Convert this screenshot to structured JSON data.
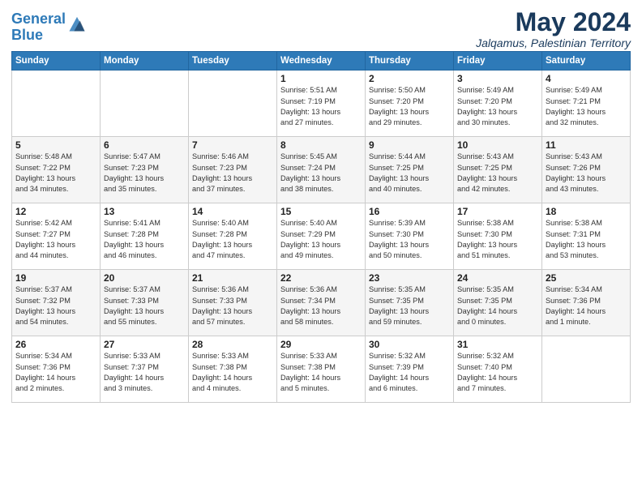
{
  "header": {
    "logo_line1": "General",
    "logo_line2": "Blue",
    "month_title": "May 2024",
    "location": "Jalqamus, Palestinian Territory"
  },
  "weekdays": [
    "Sunday",
    "Monday",
    "Tuesday",
    "Wednesday",
    "Thursday",
    "Friday",
    "Saturday"
  ],
  "weeks": [
    [
      {
        "day": "",
        "info": ""
      },
      {
        "day": "",
        "info": ""
      },
      {
        "day": "",
        "info": ""
      },
      {
        "day": "1",
        "info": "Sunrise: 5:51 AM\nSunset: 7:19 PM\nDaylight: 13 hours\nand 27 minutes."
      },
      {
        "day": "2",
        "info": "Sunrise: 5:50 AM\nSunset: 7:20 PM\nDaylight: 13 hours\nand 29 minutes."
      },
      {
        "day": "3",
        "info": "Sunrise: 5:49 AM\nSunset: 7:20 PM\nDaylight: 13 hours\nand 30 minutes."
      },
      {
        "day": "4",
        "info": "Sunrise: 5:49 AM\nSunset: 7:21 PM\nDaylight: 13 hours\nand 32 minutes."
      }
    ],
    [
      {
        "day": "5",
        "info": "Sunrise: 5:48 AM\nSunset: 7:22 PM\nDaylight: 13 hours\nand 34 minutes."
      },
      {
        "day": "6",
        "info": "Sunrise: 5:47 AM\nSunset: 7:23 PM\nDaylight: 13 hours\nand 35 minutes."
      },
      {
        "day": "7",
        "info": "Sunrise: 5:46 AM\nSunset: 7:23 PM\nDaylight: 13 hours\nand 37 minutes."
      },
      {
        "day": "8",
        "info": "Sunrise: 5:45 AM\nSunset: 7:24 PM\nDaylight: 13 hours\nand 38 minutes."
      },
      {
        "day": "9",
        "info": "Sunrise: 5:44 AM\nSunset: 7:25 PM\nDaylight: 13 hours\nand 40 minutes."
      },
      {
        "day": "10",
        "info": "Sunrise: 5:43 AM\nSunset: 7:25 PM\nDaylight: 13 hours\nand 42 minutes."
      },
      {
        "day": "11",
        "info": "Sunrise: 5:43 AM\nSunset: 7:26 PM\nDaylight: 13 hours\nand 43 minutes."
      }
    ],
    [
      {
        "day": "12",
        "info": "Sunrise: 5:42 AM\nSunset: 7:27 PM\nDaylight: 13 hours\nand 44 minutes."
      },
      {
        "day": "13",
        "info": "Sunrise: 5:41 AM\nSunset: 7:28 PM\nDaylight: 13 hours\nand 46 minutes."
      },
      {
        "day": "14",
        "info": "Sunrise: 5:40 AM\nSunset: 7:28 PM\nDaylight: 13 hours\nand 47 minutes."
      },
      {
        "day": "15",
        "info": "Sunrise: 5:40 AM\nSunset: 7:29 PM\nDaylight: 13 hours\nand 49 minutes."
      },
      {
        "day": "16",
        "info": "Sunrise: 5:39 AM\nSunset: 7:30 PM\nDaylight: 13 hours\nand 50 minutes."
      },
      {
        "day": "17",
        "info": "Sunrise: 5:38 AM\nSunset: 7:30 PM\nDaylight: 13 hours\nand 51 minutes."
      },
      {
        "day": "18",
        "info": "Sunrise: 5:38 AM\nSunset: 7:31 PM\nDaylight: 13 hours\nand 53 minutes."
      }
    ],
    [
      {
        "day": "19",
        "info": "Sunrise: 5:37 AM\nSunset: 7:32 PM\nDaylight: 13 hours\nand 54 minutes."
      },
      {
        "day": "20",
        "info": "Sunrise: 5:37 AM\nSunset: 7:33 PM\nDaylight: 13 hours\nand 55 minutes."
      },
      {
        "day": "21",
        "info": "Sunrise: 5:36 AM\nSunset: 7:33 PM\nDaylight: 13 hours\nand 57 minutes."
      },
      {
        "day": "22",
        "info": "Sunrise: 5:36 AM\nSunset: 7:34 PM\nDaylight: 13 hours\nand 58 minutes."
      },
      {
        "day": "23",
        "info": "Sunrise: 5:35 AM\nSunset: 7:35 PM\nDaylight: 13 hours\nand 59 minutes."
      },
      {
        "day": "24",
        "info": "Sunrise: 5:35 AM\nSunset: 7:35 PM\nDaylight: 14 hours\nand 0 minutes."
      },
      {
        "day": "25",
        "info": "Sunrise: 5:34 AM\nSunset: 7:36 PM\nDaylight: 14 hours\nand 1 minute."
      }
    ],
    [
      {
        "day": "26",
        "info": "Sunrise: 5:34 AM\nSunset: 7:36 PM\nDaylight: 14 hours\nand 2 minutes."
      },
      {
        "day": "27",
        "info": "Sunrise: 5:33 AM\nSunset: 7:37 PM\nDaylight: 14 hours\nand 3 minutes."
      },
      {
        "day": "28",
        "info": "Sunrise: 5:33 AM\nSunset: 7:38 PM\nDaylight: 14 hours\nand 4 minutes."
      },
      {
        "day": "29",
        "info": "Sunrise: 5:33 AM\nSunset: 7:38 PM\nDaylight: 14 hours\nand 5 minutes."
      },
      {
        "day": "30",
        "info": "Sunrise: 5:32 AM\nSunset: 7:39 PM\nDaylight: 14 hours\nand 6 minutes."
      },
      {
        "day": "31",
        "info": "Sunrise: 5:32 AM\nSunset: 7:40 PM\nDaylight: 14 hours\nand 7 minutes."
      },
      {
        "day": "",
        "info": ""
      }
    ]
  ]
}
